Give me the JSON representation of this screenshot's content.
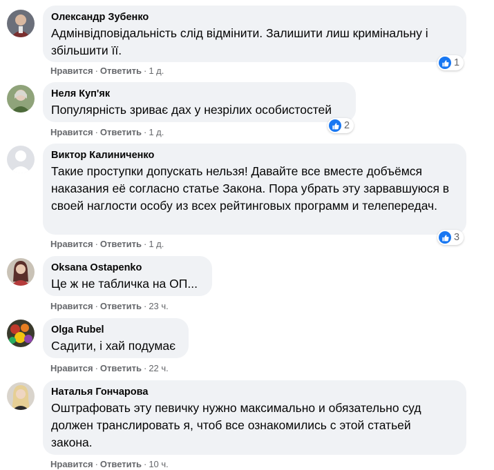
{
  "actions": {
    "like_label": "Нравится",
    "reply_label": "Ответить",
    "separator": "·"
  },
  "colors": {
    "bubble_bg": "#f0f2f5",
    "like_blue": "#1877f2",
    "meta_gray": "#65676b",
    "text": "#050505"
  },
  "comments": [
    {
      "author": "Олександр Зубенко",
      "text": "Адмінвідповідальність слід відмінити. Залишити лиш кримінальну і збільшити її.",
      "time": "1 д.",
      "reaction_icon": "like-icon",
      "reaction_count": "1"
    },
    {
      "author": "Неля Куп'як",
      "text": "Популярність зриває дах у незрілих особистостей",
      "time": "1 д.",
      "reaction_icon": "like-icon",
      "reaction_count": "2"
    },
    {
      "author": "Виктор Калиниченко",
      "text": "Такие проступки допускать нельзя! Давайте все вместе добъёмся наказания её согласно статье Закона. Пора убрать эту зарвавшуюся в своей наглости особу из всех рейтинговых программ и телепередач.",
      "time": "1 д.",
      "reaction_icon": "like-icon",
      "reaction_count": "3"
    },
    {
      "author": "Oksana Ostapenko",
      "text": "Це ж не табличка на ОП...",
      "time": "23 ч."
    },
    {
      "author": "Olga Rubel",
      "text": "Садити, і хай подумає",
      "time": "22 ч."
    },
    {
      "author": "Наталья Гончарова",
      "text": "Оштрафовать эту певичку нужно максимально и обязательно суд должен транслировать я, чтоб все ознакомились с этой статьей закона.",
      "time": "10 ч."
    }
  ]
}
